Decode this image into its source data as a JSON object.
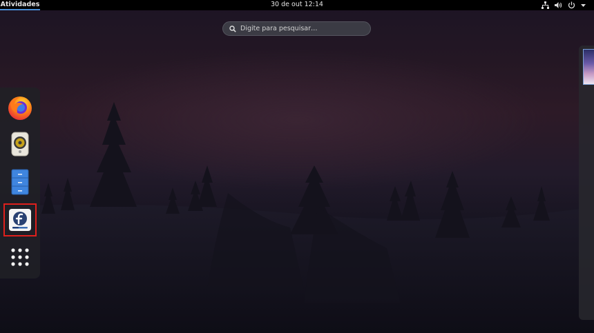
{
  "topbar": {
    "activities_label": "Atividades",
    "clock": "30 de out  12:14",
    "icons": [
      "network-icon",
      "volume-icon",
      "power-icon",
      "chevron-down-icon"
    ]
  },
  "search": {
    "placeholder": "Digite para pesquisar…"
  },
  "dash": {
    "items": [
      {
        "name": "firefox",
        "icon": "firefox-icon"
      },
      {
        "name": "rhythmbox",
        "icon": "speaker-icon"
      },
      {
        "name": "files",
        "icon": "file-cabinet-icon"
      },
      {
        "name": "fedora-media-writer",
        "icon": "fedora-icon",
        "selected": true
      },
      {
        "name": "show-applications",
        "icon": "grid-icon"
      }
    ]
  },
  "colors": {
    "topbar": "#000000",
    "accent": "#4a90d9",
    "selection": "#e0201c"
  }
}
